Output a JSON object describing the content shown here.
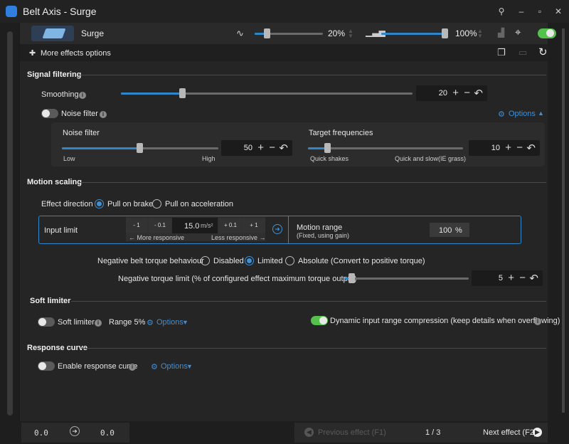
{
  "window": {
    "title": "Belt Axis - Surge",
    "effect_name": "Surge",
    "volume_pct": "20%",
    "intensity_pct": "100%"
  },
  "toolbar": {
    "more_effects_options": "More effects options"
  },
  "signal_filtering": {
    "header": "Signal filtering",
    "smoothing_label": "Smoothing",
    "smoothing_value": "20",
    "noise_filter_toggle_label": "Noise filter",
    "options_label": "Options",
    "noise_filter_label": "Noise filter",
    "noise_filter_value": "50",
    "noise_low": "Low",
    "noise_high": "High",
    "target_freq_label": "Target frequencies",
    "target_freq_value": "10",
    "quick_shakes": "Quick shakes",
    "quick_slow": "Quick and slow(IE grass)"
  },
  "motion_scaling": {
    "header": "Motion scaling",
    "effect_direction_label": "Effect direction",
    "direction_options": [
      "Pull on brake",
      "Pull on acceleration"
    ],
    "input_limit_label": "Input limit",
    "steps": [
      "- 1",
      "- 0.1",
      "+ 0.1",
      "+ 1"
    ],
    "input_value": "15.0",
    "input_unit": "m/s²",
    "more_responsive": "← More responsive",
    "less_responsive": "Less responsive →",
    "motion_range_label": "Motion range",
    "motion_range_sub": "(Fixed, using gain)",
    "motion_range_value": "100",
    "motion_range_unit": "%",
    "neg_torque_label": "Negative belt torque behaviour",
    "neg_torque_options": [
      "Disabled",
      "Limited",
      "Absolute (Convert to positive torque)"
    ],
    "neg_limit_label": "Negative torque limit (% of configured effect maximum torque output)",
    "neg_limit_value": "5"
  },
  "soft_limiter": {
    "header": "Soft limiter",
    "toggle_label": "Soft limiter",
    "range_label": "Range 5%",
    "options_label": "Options",
    "dynamic_label": "Dynamic input range compression (keep details when overflowing)"
  },
  "response_curve": {
    "header": "Response curve",
    "toggle_label": "Enable response curve",
    "options_label": "Options"
  },
  "footer": {
    "left_value": "0.0",
    "right_value": "0.0",
    "prev_label": "Previous effect (F1)",
    "page": "1 / 3",
    "next_label": "Next effect (F2)"
  },
  "colors": {
    "accent": "#2f86c8",
    "toggle_on": "#53c14b"
  }
}
